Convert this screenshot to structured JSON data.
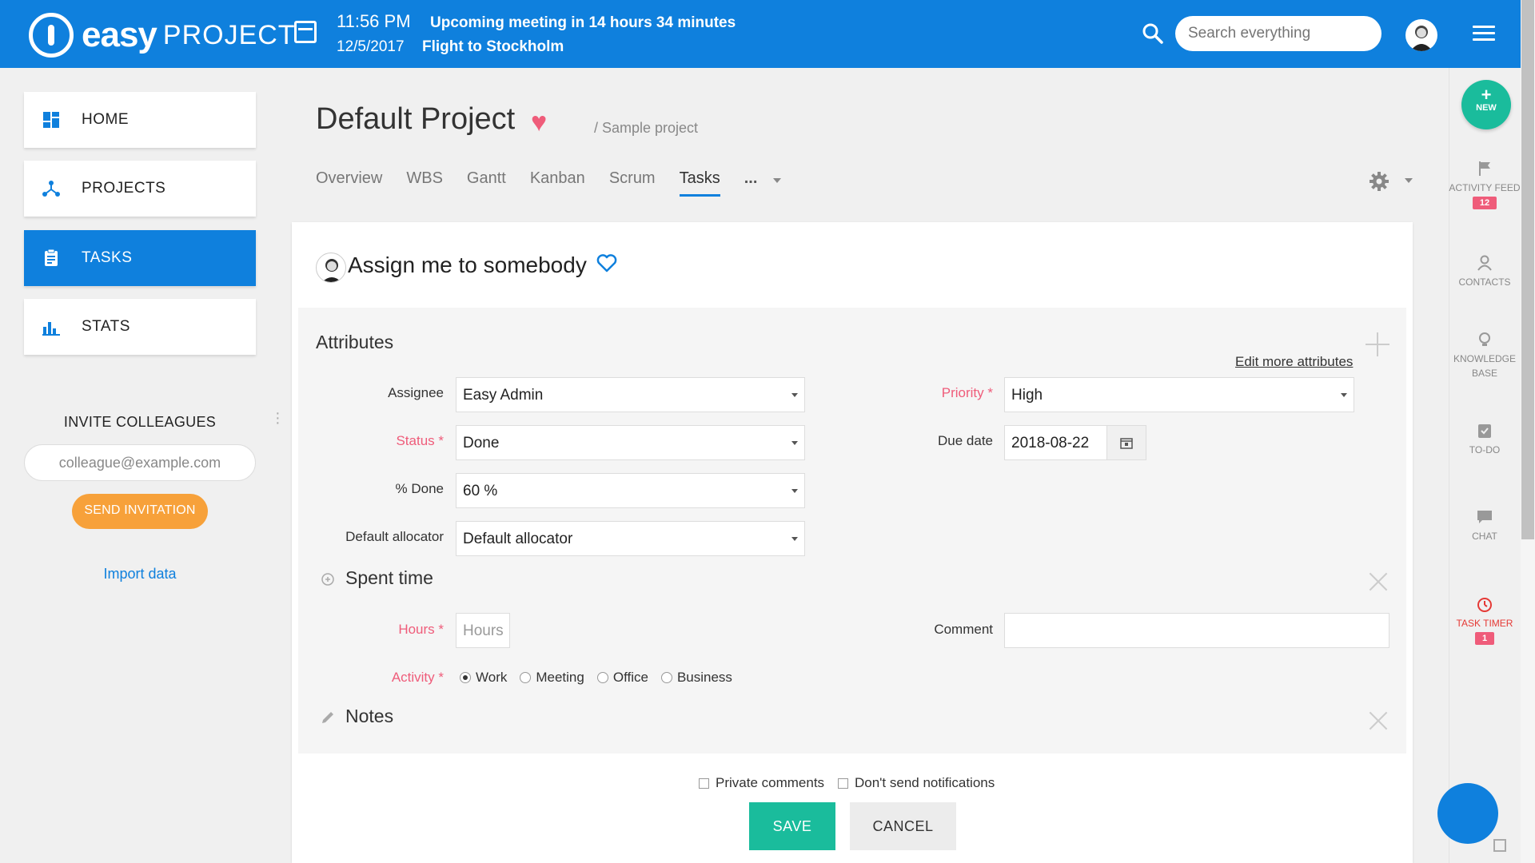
{
  "header": {
    "logo_bold": "easy",
    "logo_light": "PROJECT",
    "meeting_time": "11:56 PM",
    "meeting_date": "12/5/2017",
    "meeting_title": "Upcoming meeting in 14 hours 34 minutes",
    "meeting_subtitle": "Flight to Stockholm",
    "search_placeholder": "Search everything"
  },
  "sidebar": {
    "items": [
      {
        "label": "HOME",
        "icon": "dashboard-icon"
      },
      {
        "label": "PROJECTS",
        "icon": "projects-icon"
      },
      {
        "label": "TASKS",
        "icon": "clipboard-icon",
        "active": true
      },
      {
        "label": "STATS",
        "icon": "bar-chart-icon"
      }
    ],
    "invite_title": "INVITE COLLEAGUES",
    "invite_placeholder": "colleague@example.com",
    "invite_button": "SEND INVITATION",
    "import_link": "Import data"
  },
  "project": {
    "title": "Default Project",
    "breadcrumb": "/ Sample project",
    "tabs": [
      "Overview",
      "WBS",
      "Gantt",
      "Kanban",
      "Scrum",
      "Tasks"
    ],
    "active_tab": "Tasks",
    "more": "..."
  },
  "task": {
    "title": "Assign me to somebody",
    "attributes": {
      "section_title": "Attributes",
      "edit_more": "Edit more attributes",
      "assignee_label": "Assignee",
      "assignee_value": "Easy Admin",
      "status_label": "Status *",
      "status_value": "Done",
      "done_label": "% Done",
      "done_value": "60 %",
      "allocator_label": "Default allocator",
      "allocator_value": "Default allocator",
      "priority_label": "Priority *",
      "priority_value": "High",
      "due_label": "Due date",
      "due_value": "2018-08-22"
    },
    "spent_time": {
      "section_title": "Spent time",
      "hours_label": "Hours *",
      "hours_placeholder": "Hours",
      "comment_label": "Comment",
      "activity_label": "Activity *",
      "activities": [
        "Work",
        "Meeting",
        "Office",
        "Business"
      ],
      "selected_activity": "Work"
    },
    "notes": {
      "section_title": "Notes"
    },
    "private_comments": "Private comments",
    "dont_notify": "Don't send notifications",
    "save": "SAVE",
    "cancel": "CANCEL"
  },
  "rail": {
    "new_label": "NEW",
    "activity_feed": "ACTIVITY FEED",
    "activity_badge": "12",
    "contacts": "CONTACTS",
    "knowledge_base": "KNOWLEDGE BASE",
    "todo": "TO-DO",
    "chat": "CHAT",
    "task_timer": "TASK TIMER",
    "timer_badge": "1"
  },
  "colors": {
    "brand_blue": "#0f80dd",
    "accent_green": "#1abc9c",
    "required_pink": "#ef5c7a",
    "invite_orange": "#f7a13a"
  }
}
